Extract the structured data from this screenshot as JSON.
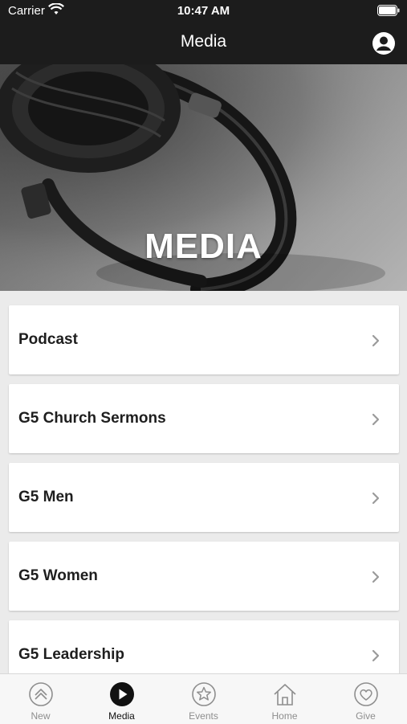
{
  "status_bar": {
    "carrier": "Carrier",
    "time": "10:47 AM"
  },
  "nav": {
    "title": "Media"
  },
  "hero": {
    "title": "MEDIA"
  },
  "menu": [
    {
      "label": "Podcast"
    },
    {
      "label": "G5 Church Sermons"
    },
    {
      "label": "G5 Men"
    },
    {
      "label": "G5 Women"
    },
    {
      "label": "G5 Leadership"
    }
  ],
  "tabs": [
    {
      "label": "New",
      "icon": "chevron-up-circle-icon"
    },
    {
      "label": "Media",
      "icon": "play-circle-icon"
    },
    {
      "label": "Events",
      "icon": "star-circle-icon"
    },
    {
      "label": "Home",
      "icon": "home-icon"
    },
    {
      "label": "Give",
      "icon": "heart-circle-icon"
    }
  ],
  "colors": {
    "bar_background": "#1c1c1c",
    "page_background": "#ebebeb",
    "tab_inactive": "#8e8e8e",
    "tab_active": "#111111"
  }
}
